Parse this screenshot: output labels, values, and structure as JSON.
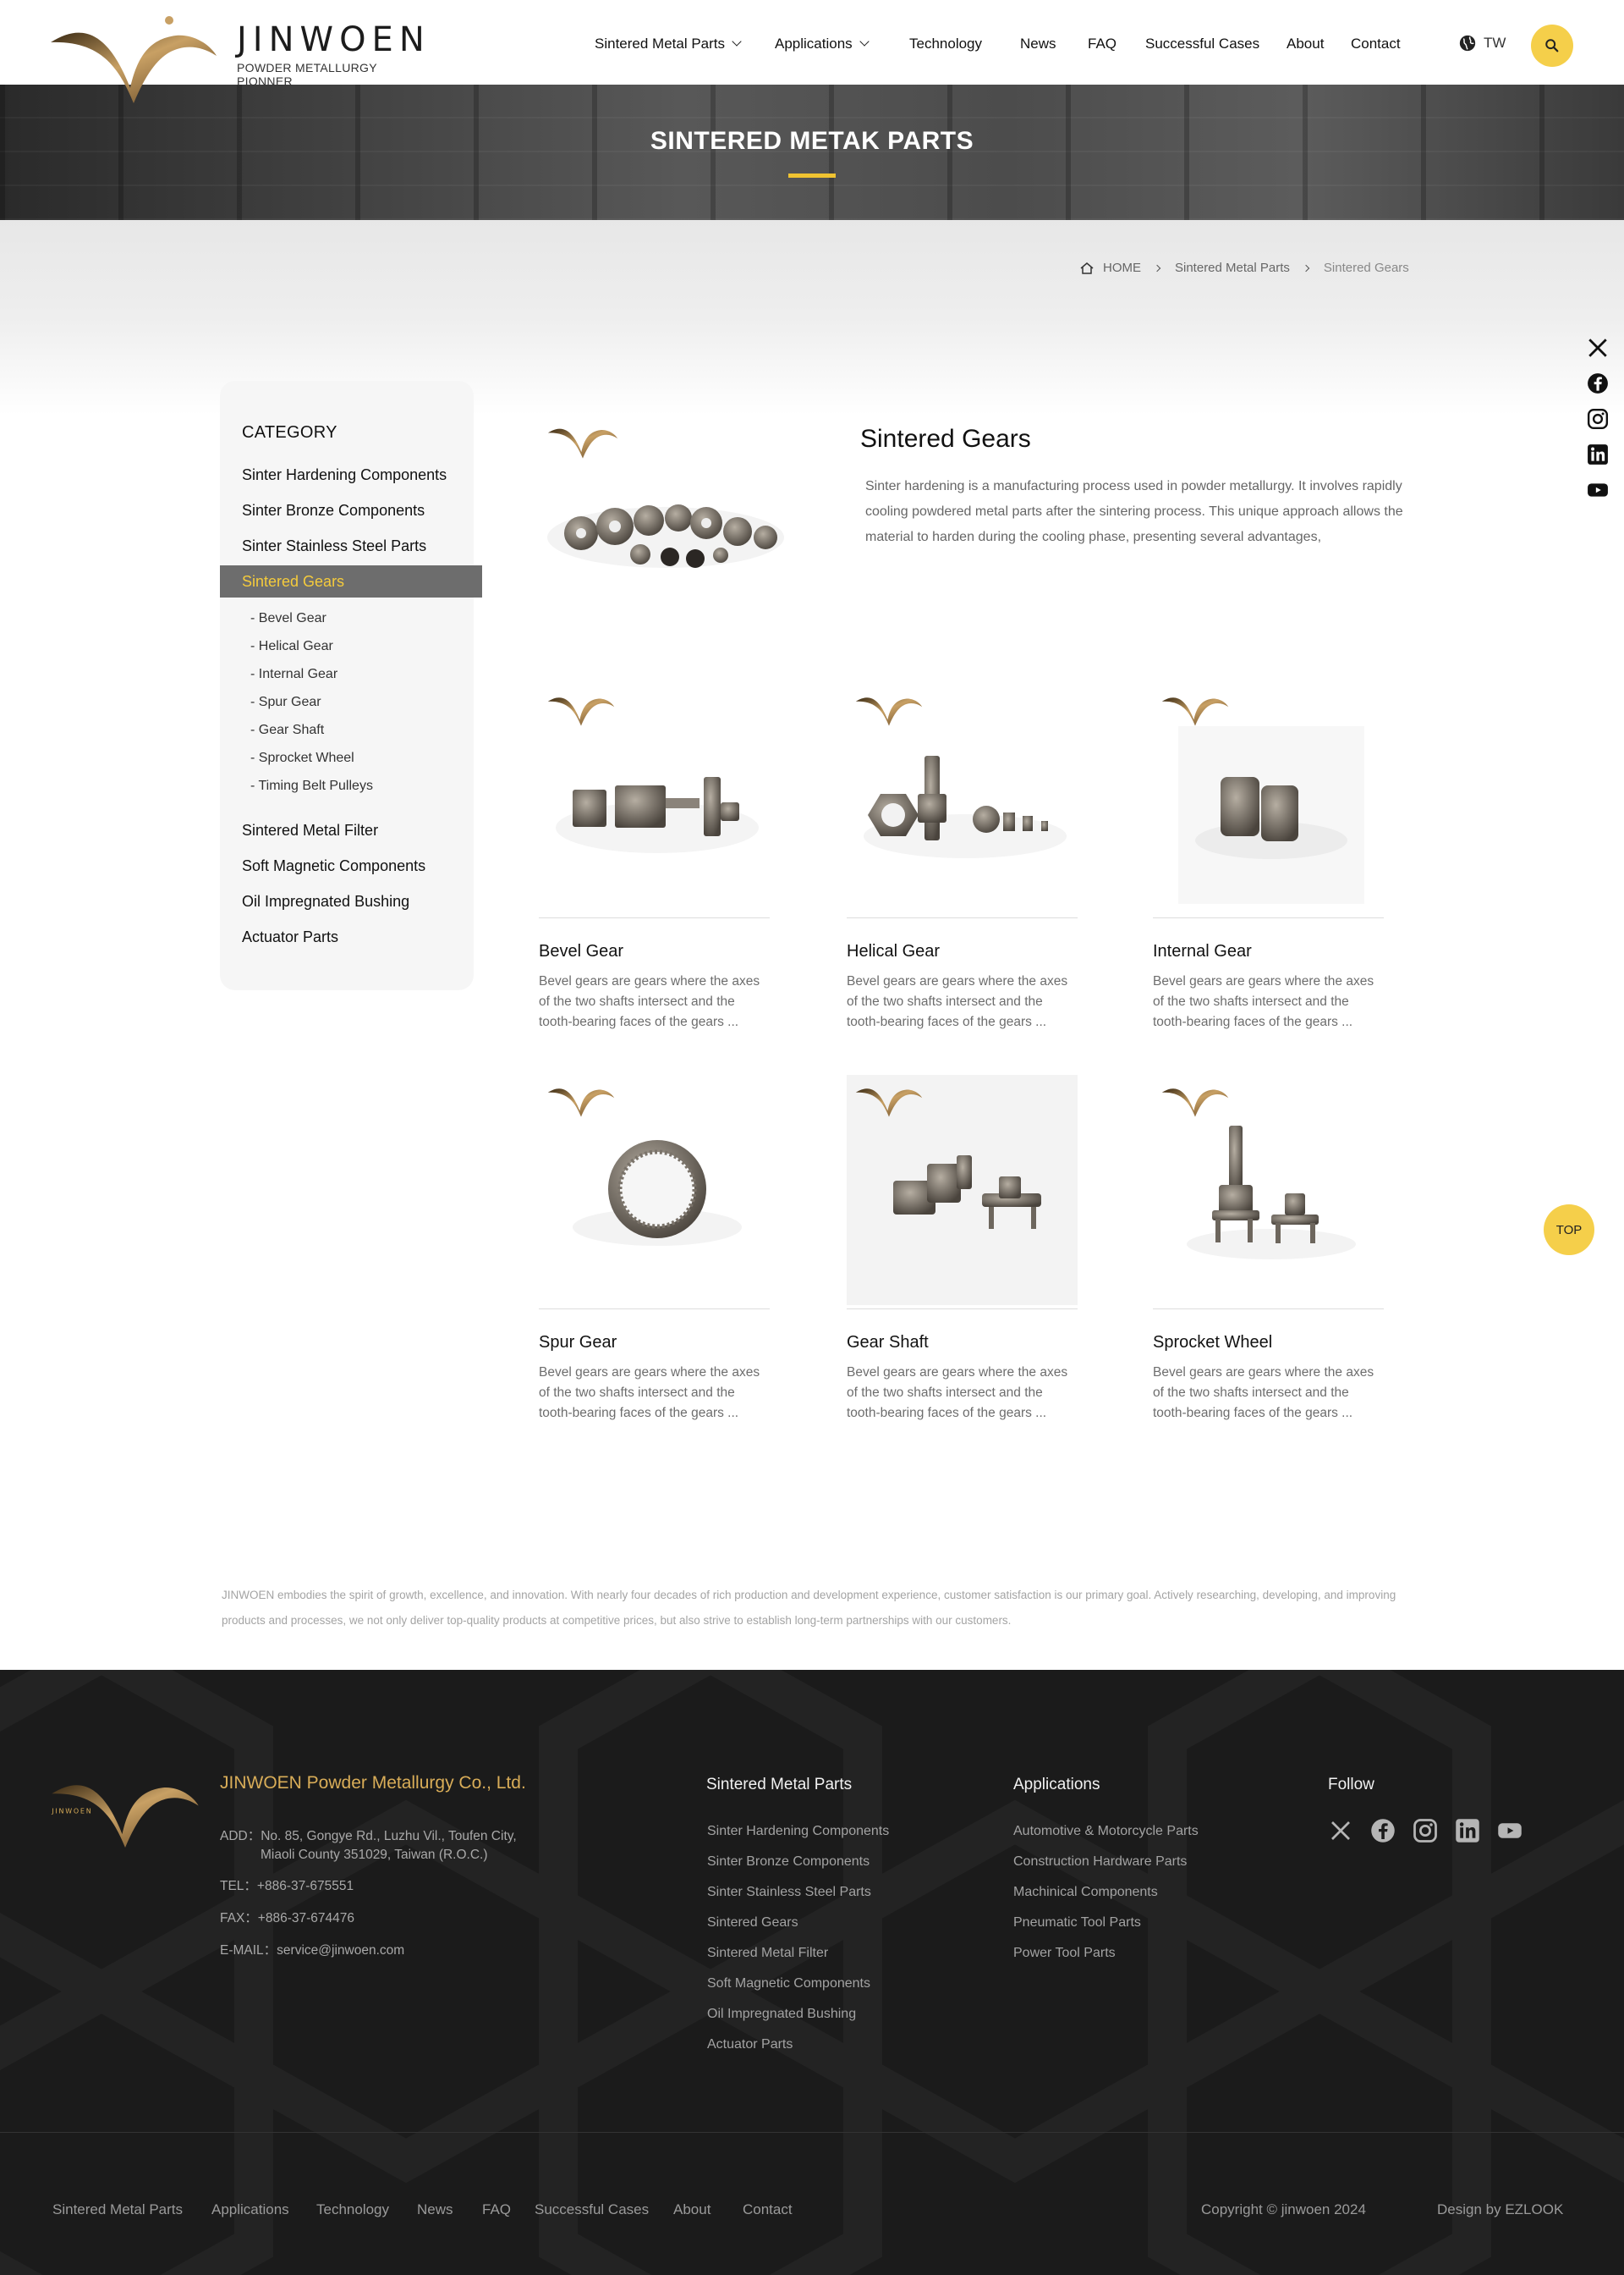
{
  "header": {
    "brand_name": "JINWOEN",
    "brand_tagline": "POWDER METALLURGY PIONNER",
    "nav": [
      "Sintered Metal Parts",
      "Applications",
      "Technology",
      "News",
      "FAQ",
      "Successful Cases",
      "About",
      "Contact"
    ],
    "lang": "TW"
  },
  "hero": {
    "title": "SINTERED METAK PARTS"
  },
  "breadcrumb": {
    "home": "HOME",
    "level1": "Sintered Metal Parts",
    "current": "Sintered Gears"
  },
  "sidebar": {
    "title": "CATEGORY",
    "items_top": [
      "Sinter Hardening Components",
      "Sinter Bronze Components",
      "Sinter Stainless Steel Parts"
    ],
    "active": "Sintered Gears",
    "subitems": [
      "- Bevel Gear",
      "- Helical Gear",
      "- Internal Gear",
      "- Spur Gear",
      "- Gear Shaft",
      "- Sprocket Wheel",
      "- Timing Belt Pulleys"
    ],
    "items_bottom": [
      "Sintered Metal Filter",
      "Soft Magnetic Components",
      "Oil Impregnated Bushing",
      "Actuator Parts"
    ]
  },
  "feature": {
    "title": "Sintered Gears",
    "description": "Sinter hardening is a manufacturing process used in powder metallurgy. It involves rapidly cooling powdered metal parts after the sintering process. This unique  approach allows the material to harden during the cooling phase, presenting several advantages,"
  },
  "products": [
    {
      "name": "Bevel Gear",
      "desc": "Bevel gears are gears where the axes  of the two shafts intersect and the tooth-bearing faces of the gears ..."
    },
    {
      "name": "Helical Gear",
      "desc": "Bevel gears are gears where the axes  of the two shafts intersect and the tooth-bearing faces of the gears ..."
    },
    {
      "name": "Internal Gear",
      "desc": "Bevel gears are gears where the axes  of the two shafts intersect and the tooth-bearing faces of the gears ..."
    },
    {
      "name": "Spur Gear",
      "desc": "Bevel gears are gears where the axes  of the two shafts intersect and the tooth-bearing faces of the gears ..."
    },
    {
      "name": "Gear Shaft",
      "desc": "Bevel gears are gears where the axes  of the two shafts intersect and the tooth-bearing faces of the gears ..."
    },
    {
      "name": "Sprocket Wheel",
      "desc": "Bevel gears are gears where the axes  of the two shafts intersect and the tooth-bearing faces of the gears ..."
    }
  ],
  "intro": "JINWOEN embodies the spirit of growth, excellence, and innovation. With nearly four decades of rich production and development experience, customer satisfaction is our primary goal. Actively researching, developing, and improving products and processes, we not only deliver top-quality products at competitive prices, but also strive to establish long-term partnerships with our customers.",
  "footer": {
    "logo_text": "JINWOEN",
    "company": "JINWOEN Powder Metallurgy Co., Ltd.",
    "address_label": "ADD：",
    "address_line1": "No. 85, Gongye Rd., Luzhu Vil., Toufen City,",
    "address_line2": "Miaoli County 351029, Taiwan (R.O.C.)",
    "tel": "TEL：+886-37-675551",
    "fax": "FAX：+886-37-674476",
    "email": "E-MAIL：service@jinwoen.com",
    "col1_title": "Sintered Metal Parts",
    "col1_links": [
      "Sinter Hardening Components",
      "Sinter Bronze Components",
      "Sinter Stainless Steel Parts",
      "Sintered Gears",
      "Sintered Metal Filter",
      "Soft Magnetic Components",
      "Oil Impregnated Bushing",
      "Actuator Parts"
    ],
    "col2_title": "Applications",
    "col2_links": [
      "Automotive & Motorcycle Parts",
      "Construction Hardware Parts",
      "Machinical Components",
      "Pneumatic Tool Parts",
      "Power Tool Parts"
    ],
    "col3_title": "Follow",
    "bottom_nav": [
      "Sintered Metal Parts",
      "Applications",
      "Technology",
      "News",
      "FAQ",
      "Successful Cases",
      "About",
      "Contact"
    ],
    "copyright": "Copyright © jinwoen 2024",
    "design": "Design by EZLOOK",
    "top_label": "TOP"
  },
  "colors": {
    "accent": "#f5cf4a",
    "gold": "#d9ad58",
    "active_bg": "#6d6d6d",
    "footer_bg": "#1b1b1b"
  },
  "icons": [
    "home-icon",
    "globe-icon",
    "search-icon",
    "x-icon",
    "facebook-icon",
    "instagram-icon",
    "linkedin-icon",
    "youtube-icon",
    "chevron-down-icon",
    "chevron-right-icon"
  ]
}
